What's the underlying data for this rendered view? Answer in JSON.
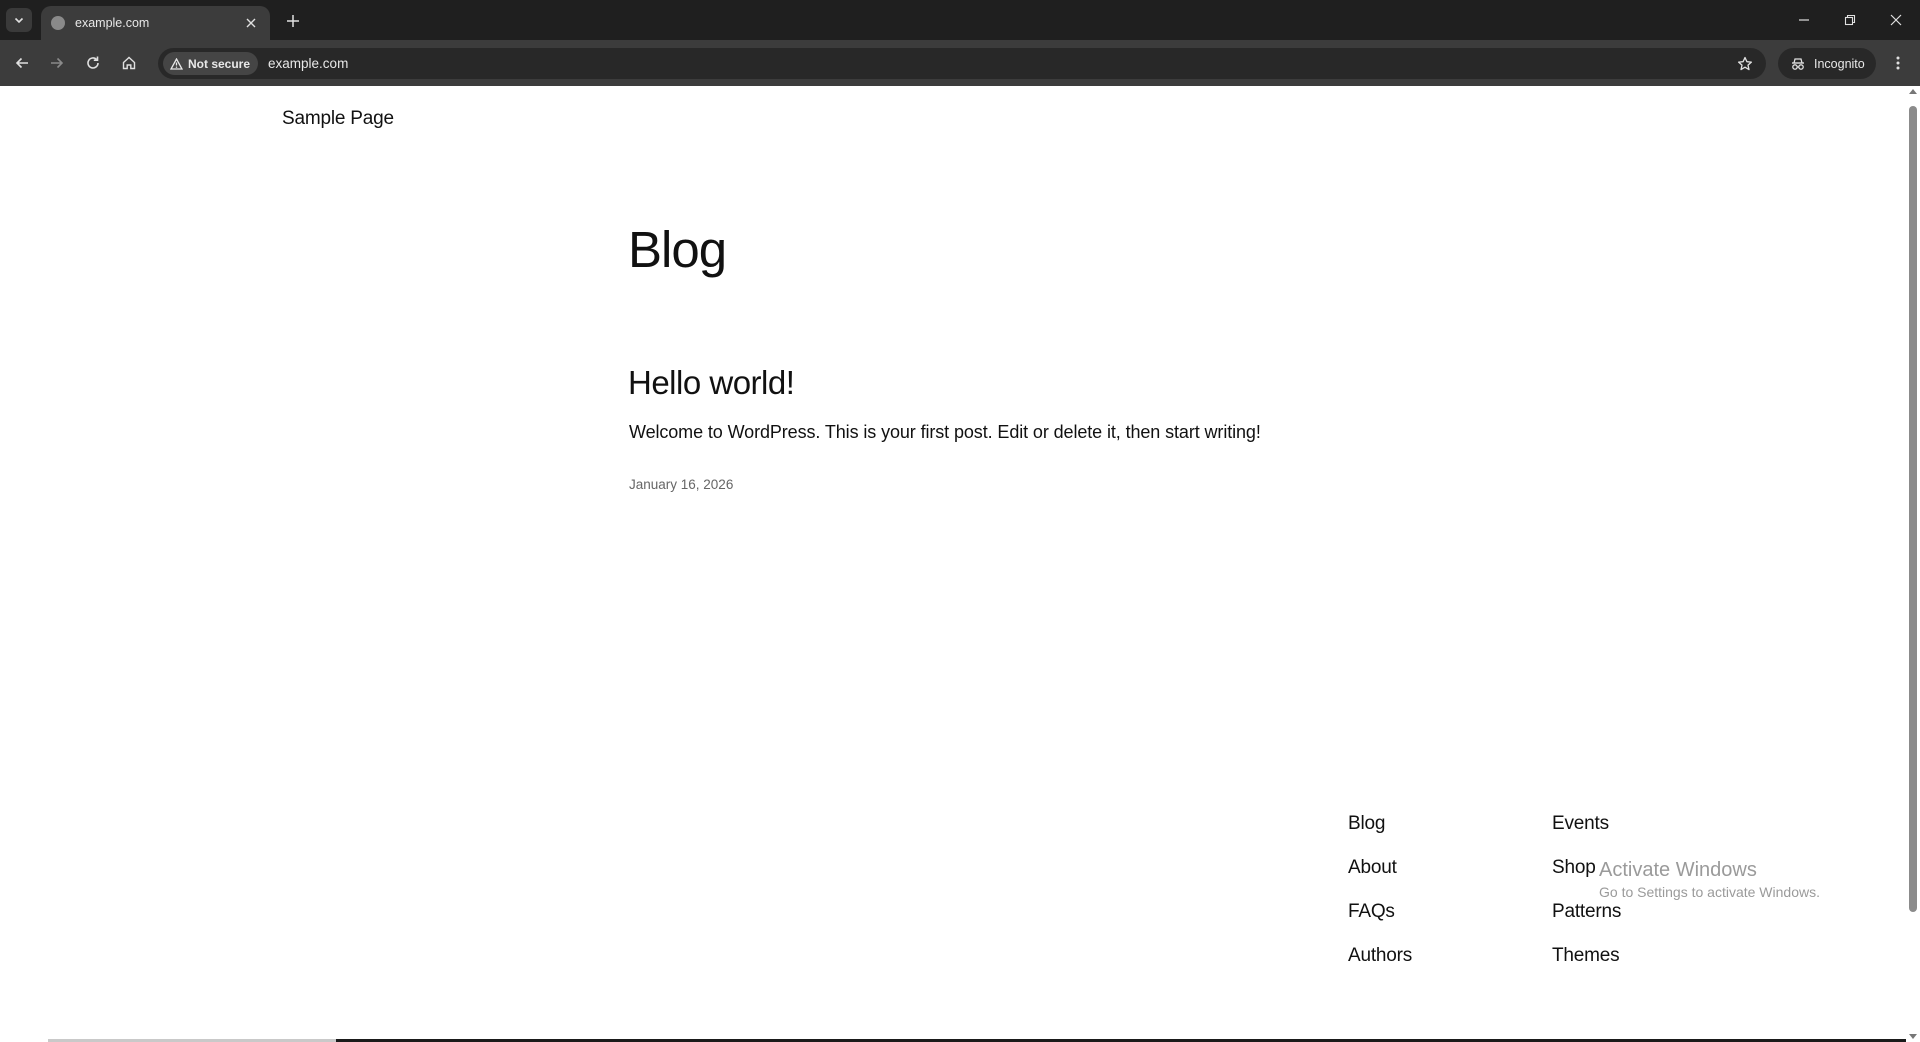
{
  "browser": {
    "tab": {
      "title": "example.com"
    },
    "address_bar": {
      "security_label": "Not secure",
      "url": "example.com"
    },
    "profile": {
      "label": "Incognito"
    }
  },
  "site": {
    "header": {
      "nav_link": "Sample Page"
    },
    "main": {
      "heading": "Blog",
      "posts": [
        {
          "title": "Hello world!",
          "excerpt": "Welcome to WordPress. This is your first post. Edit or delete it, then start writing!",
          "date": "January 16, 2026"
        }
      ]
    },
    "footer": {
      "column_1": [
        "Blog",
        "About",
        "FAQs",
        "Authors"
      ],
      "column_2": [
        "Events",
        "Shop",
        "Patterns",
        "Themes"
      ]
    }
  },
  "os_watermark": {
    "title": "Activate Windows",
    "subtitle": "Go to Settings to activate Windows."
  },
  "colors": {
    "tabbar_bg": "#1f1f1f",
    "toolbar_bg": "#3c3c3c",
    "omnibox_bg": "#282828",
    "page_bg": "#ffffff",
    "text": "#111111"
  },
  "icons": [
    "chevron-down-icon",
    "globe-icon",
    "close-icon",
    "plus-icon",
    "minimize-icon",
    "restore-icon",
    "back-icon",
    "forward-icon",
    "reload-icon",
    "home-icon",
    "warning-icon",
    "star-icon",
    "incognito-icon",
    "kebab-menu-icon"
  ]
}
